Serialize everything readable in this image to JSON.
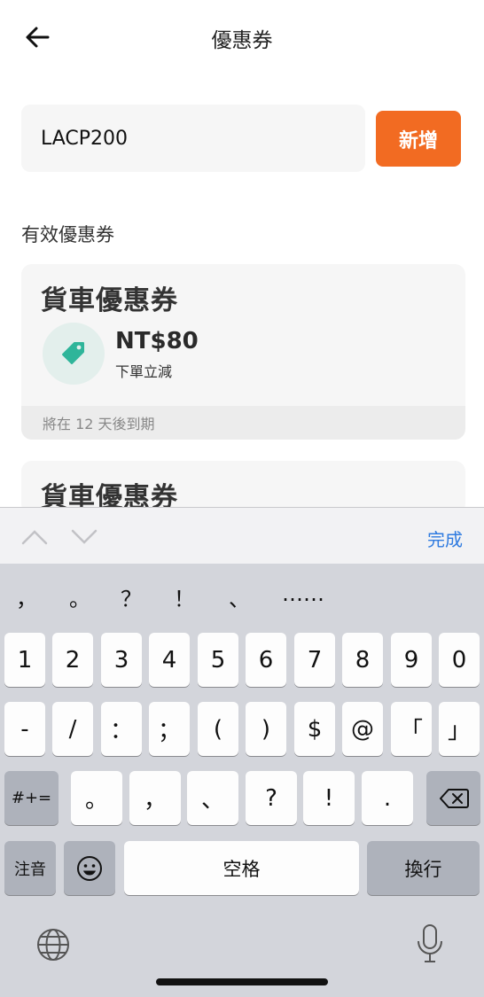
{
  "header": {
    "title": "優惠券"
  },
  "coupon_input": {
    "value": "LACP200"
  },
  "add_button": {
    "label": "新增"
  },
  "section": {
    "label": "有效優惠券"
  },
  "coupons": [
    {
      "title": "貨車優惠券",
      "amount": "NT$80",
      "description": "下單立減",
      "expiry": "將在 12 天後到期"
    },
    {
      "title": "貨車優惠券"
    }
  ],
  "keyboard": {
    "done_label": "完成",
    "punctuation_row": [
      "，",
      "。",
      "？",
      "！",
      "、",
      "……"
    ],
    "row1": [
      "1",
      "2",
      "3",
      "4",
      "5",
      "6",
      "7",
      "8",
      "9",
      "0"
    ],
    "row2": [
      "-",
      "/",
      "：",
      "；",
      "(",
      ")",
      "$",
      "@",
      "「",
      "」"
    ],
    "row3_left": "#+=",
    "row3": [
      "。",
      "，",
      "、",
      "?",
      "!",
      "."
    ],
    "row4": {
      "zhuyin": "注音",
      "space": "空格",
      "return": "換行"
    }
  },
  "colors": {
    "accent": "#f26b22",
    "link": "#2f7be0",
    "tag_icon": "#2fb59a"
  }
}
